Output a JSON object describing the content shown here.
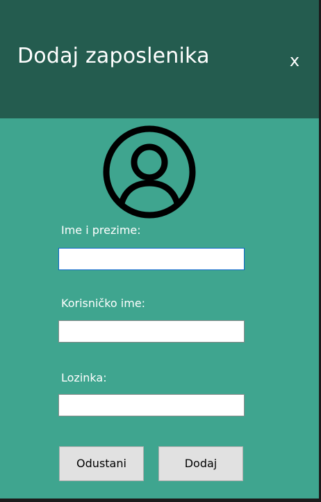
{
  "window": {
    "title": "Dodaj zaposlenika",
    "close_label": "x"
  },
  "avatar": {
    "icon": "user-circle-icon"
  },
  "form": {
    "full_name": {
      "label": "Ime i prezime:",
      "value": "",
      "placeholder": ""
    },
    "username": {
      "label": "Korisničko ime:",
      "value": "",
      "placeholder": ""
    },
    "password": {
      "label": "Lozinka:",
      "value": "",
      "placeholder": ""
    }
  },
  "buttons": {
    "cancel_label": "Odustani",
    "add_label": "Dodaj"
  },
  "colors": {
    "header": "#245c4f",
    "body": "#3fa58f",
    "button": "#e1e1e1",
    "focus_border": "#0a64c8"
  }
}
